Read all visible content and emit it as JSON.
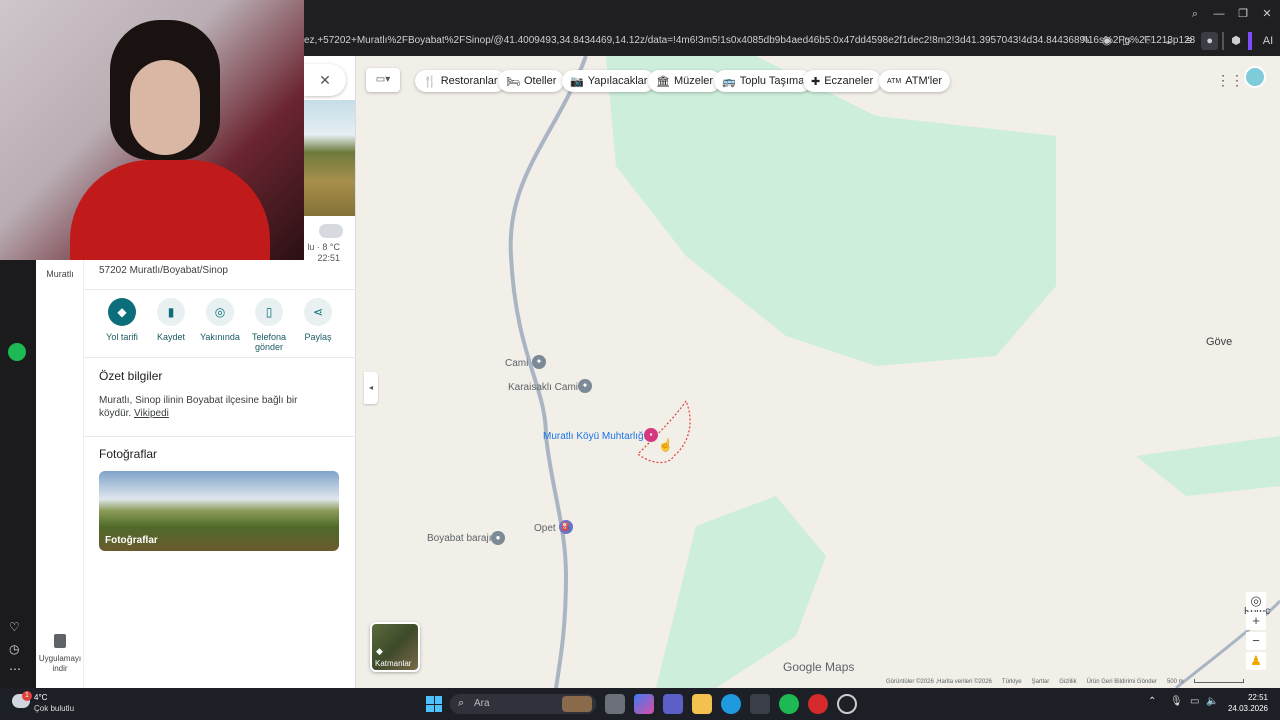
{
  "browser": {
    "url": "ez,+57202+Muratlı%2FBoyabat%2FSinop/@41.4009493,34.8434469,14.12z/data=!4m6!3m5!1s0x4085db9b4aed46b5:0x47dd4598e2f1dec2!8m2!3d41.3957043!4d34.8443689!16s%2Fg%2F1213p128",
    "ai_label": "AI"
  },
  "panel": {
    "weather": {
      "text": "lu · 8 °C",
      "time": "22:51"
    },
    "address": "57202 Muratlı/Boyabat/Sinop",
    "rail_label": "Muratlı",
    "actions": [
      {
        "label": "Yol tarifi",
        "icon": "directions-icon"
      },
      {
        "label": "Kaydet",
        "icon": "bookmark-icon"
      },
      {
        "label": "Yakınında",
        "icon": "nearby-icon"
      },
      {
        "label": "Telefona gönder",
        "icon": "phone-icon"
      },
      {
        "label": "Paylaş",
        "icon": "share-icon"
      }
    ],
    "summary_title": "Özet bilgiler",
    "summary_text": "Muratlı, Sinop ilinin Boyabat ilçesine bağlı bir köydür.",
    "summary_link": "Vikipedi",
    "photos_title": "Fotoğraflar",
    "photos_caption": "Fotoğraflar",
    "app_download": "Uygulamayı indir"
  },
  "chips": [
    {
      "label": "Restoranlar",
      "icon": "🍴"
    },
    {
      "label": "Oteller",
      "icon": "🛏"
    },
    {
      "label": "Yapılacaklar",
      "icon": "📷"
    },
    {
      "label": "Müzeler",
      "icon": "🏛"
    },
    {
      "label": "Toplu Taşıma",
      "icon": "🚌"
    },
    {
      "label": "Eczaneler",
      "icon": "✚"
    },
    {
      "label": "ATM'ler",
      "icon": "ATM"
    }
  ],
  "map": {
    "labels": {
      "cami": "Cami",
      "karaisakli": "Karaisaklı Cami",
      "muhtarlik": "Muratlı Köyü Muhtarlığı",
      "opet": "Opet",
      "baraj": "Boyabat barajı",
      "gove": "Göve",
      "koru": "Koruc"
    },
    "layers_label": "Katmanlar",
    "brand": "Google Maps",
    "footer": [
      "Görüntüler ©2026 ,Harita verileri ©2026",
      "Türkiye",
      "Şartlar",
      "Gizlilik",
      "Ürün Geri Bildirimi Gönder",
      "500 m"
    ]
  },
  "taskbar": {
    "weather_temp": "4°C",
    "weather_desc": "Çok bulutlu",
    "search_placeholder": "Ara",
    "time": "22:51",
    "date": "24.03.2026",
    "badge": "1"
  },
  "colors": {
    "accent": "#0b6e7a",
    "map_bg": "#f1efe8",
    "forest": "#cdeedb",
    "road": "#aab5c4",
    "boundary": "#e0413a",
    "poi_pink": "#d4387f"
  }
}
